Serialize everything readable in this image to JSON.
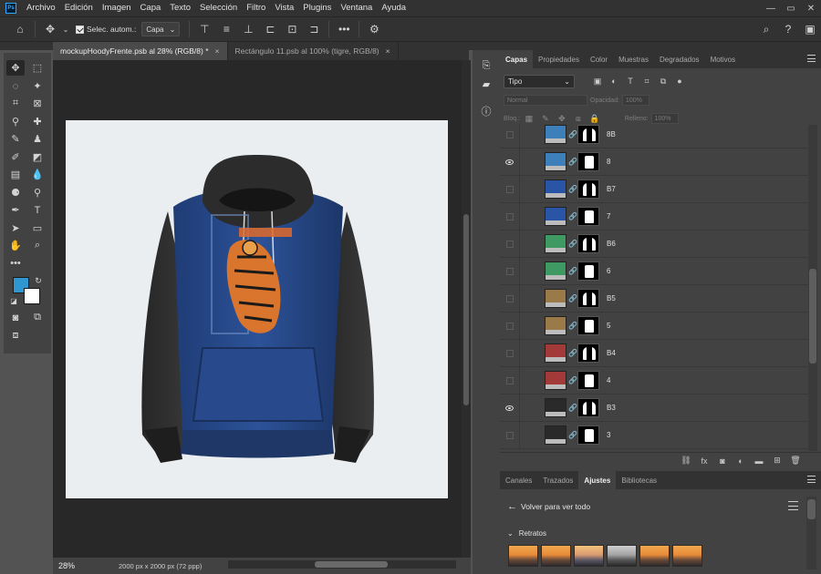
{
  "menu": {
    "items": [
      "Archivo",
      "Edición",
      "Imagen",
      "Capa",
      "Texto",
      "Selección",
      "Filtro",
      "Vista",
      "Plugins",
      "Ventana",
      "Ayuda"
    ],
    "logo": "Ps"
  },
  "options": {
    "auto_select_label": "Selec. autom.:",
    "target_value": "Capa"
  },
  "doc_tabs": [
    {
      "label": "mockupHoodyFrente.psb al 28% (RGB/8) *",
      "close": "×"
    },
    {
      "label": "Rectángulo 11.psb al 100% (tigre, RGB/8)",
      "close": "×"
    }
  ],
  "status": {
    "zoom": "28%",
    "doc_size": "2000 px x 2000 px (72 ppp)"
  },
  "layers_panel": {
    "tabs": [
      "Capas",
      "Propiedades",
      "Color",
      "Muestras",
      "Degradados",
      "Motivos"
    ],
    "filter_value": "Tipo",
    "blend_mode": "Normal",
    "opacity_label": "Opacidad:",
    "opacity_value": "100%",
    "lock_label": "Bloq.:",
    "fill_label": "Relleno:",
    "fill_value": "100%",
    "colors": {
      "blue_light": "#3d7fb8",
      "blue_dark": "#2a55a6",
      "green": "#3e9a62",
      "tan": "#9a7a48",
      "red": "#a23a3a",
      "charcoal": "#2a2a2a"
    },
    "layers": [
      {
        "name": "8B",
        "visible": false,
        "color": "#3d7fb8",
        "mask": "hood"
      },
      {
        "name": "8",
        "visible": true,
        "color": "#3d7fb8",
        "mask": "body"
      },
      {
        "name": "B7",
        "visible": false,
        "color": "#2a55a6",
        "mask": "hood"
      },
      {
        "name": "7",
        "visible": false,
        "color": "#2a55a6",
        "mask": "body"
      },
      {
        "name": "B6",
        "visible": false,
        "color": "#3e9a62",
        "mask": "hood"
      },
      {
        "name": "6",
        "visible": false,
        "color": "#3e9a62",
        "mask": "body"
      },
      {
        "name": "B5",
        "visible": false,
        "color": "#9a7a48",
        "mask": "hood"
      },
      {
        "name": "5",
        "visible": false,
        "color": "#9a7a48",
        "mask": "body"
      },
      {
        "name": "B4",
        "visible": false,
        "color": "#a23a3a",
        "mask": "hood"
      },
      {
        "name": "4",
        "visible": false,
        "color": "#a23a3a",
        "mask": "body"
      },
      {
        "name": "B3",
        "visible": true,
        "color": "#2a2a2a",
        "mask": "hood"
      },
      {
        "name": "3",
        "visible": false,
        "color": "#2a2a2a",
        "mask": "body"
      }
    ]
  },
  "adjustments_panel": {
    "tabs": [
      "Canales",
      "Trazados",
      "Ajustes",
      "Bibliotecas"
    ],
    "back_label": "Volver para ver todo",
    "section": "Retratos",
    "presets": [
      "warm",
      "warm",
      "cool",
      "gray",
      "warm",
      "warm"
    ]
  },
  "colors": {
    "foreground": "#2f96cf",
    "background": "#ffffff",
    "canvas_bg": "#ebeef0"
  }
}
